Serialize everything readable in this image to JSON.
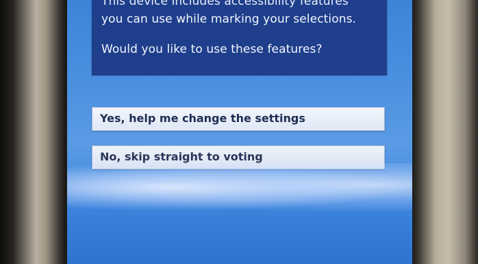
{
  "info_panel": {
    "line_top": "This device includes accessibility features",
    "line_1": "you can use while marking your selections.",
    "line_2": "Would you like to use these features?"
  },
  "options": {
    "yes_label": "Yes, help me change the settings",
    "no_label": "No, skip straight to voting"
  }
}
